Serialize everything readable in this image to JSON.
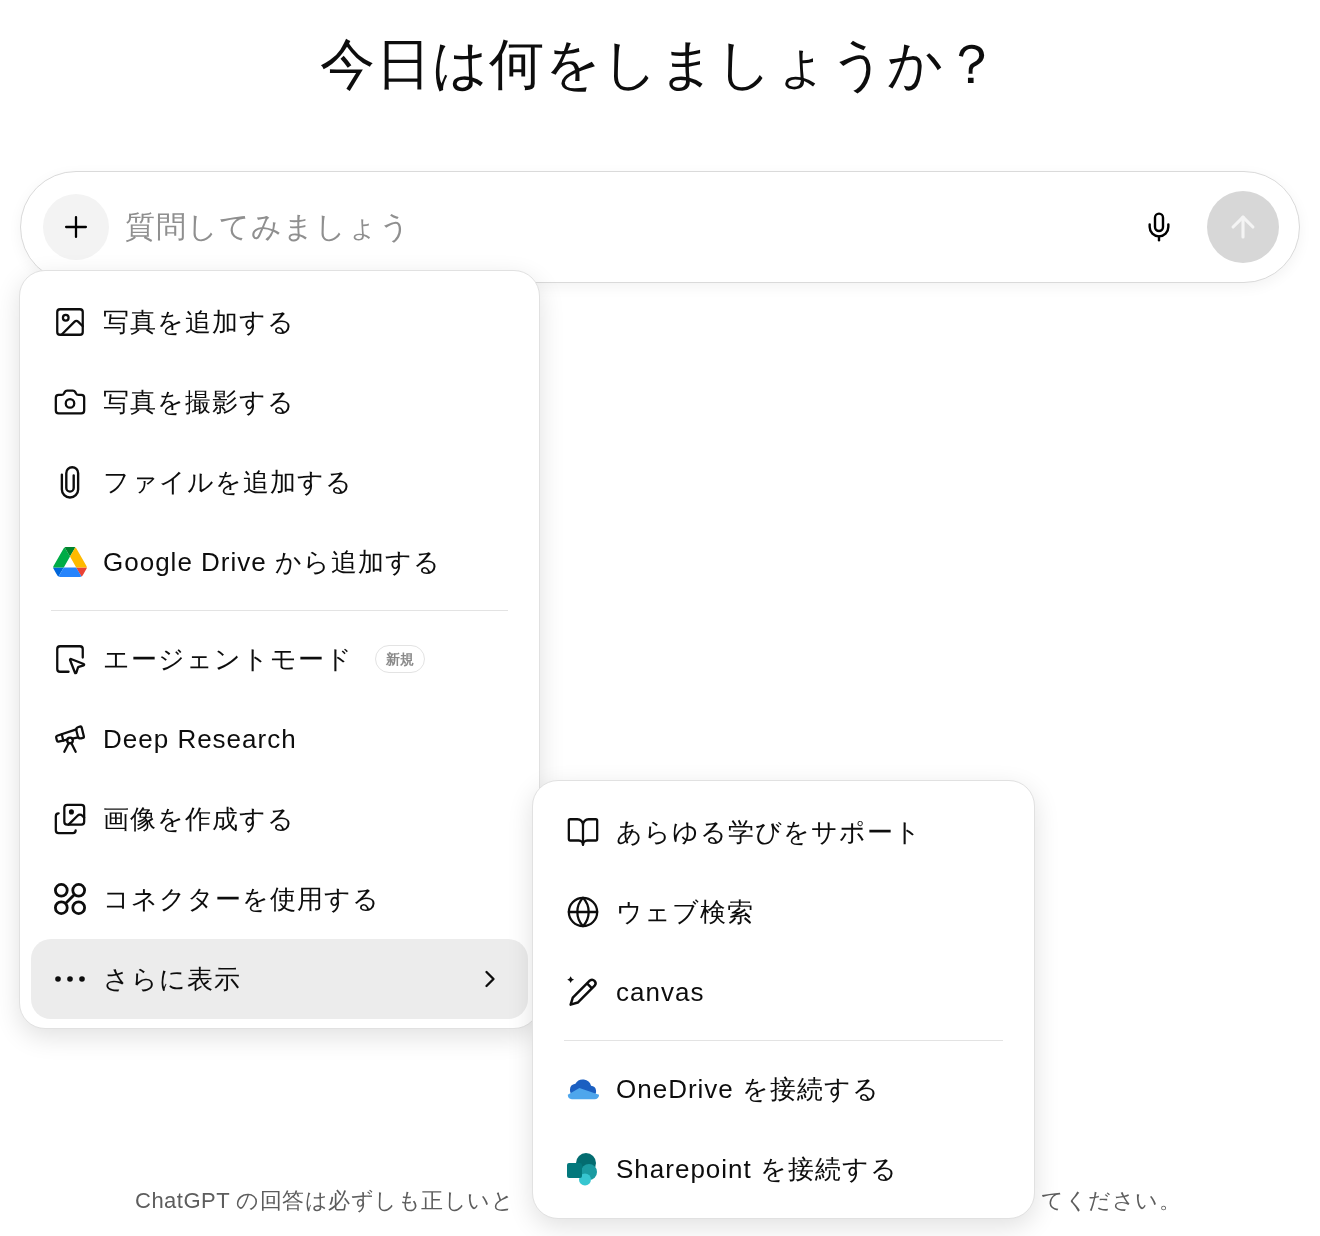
{
  "heading": "今日は何をしましょうか？",
  "composer": {
    "placeholder": "質問してみましょう",
    "send_button": {
      "disabled": true
    }
  },
  "attach_menu": {
    "sections": [
      [
        {
          "label": "写真を追加する",
          "kind": "action",
          "selected": false
        },
        {
          "label": "写真を撮影する",
          "kind": "action",
          "selected": false
        },
        {
          "label": "ファイルを追加する",
          "kind": "action",
          "selected": false
        },
        {
          "label": "Google Drive から追加する",
          "kind": "action",
          "selected": false
        }
      ],
      [
        {
          "label": "エージェントモード",
          "kind": "action",
          "badge": "新規",
          "selected": false
        },
        {
          "label": "Deep Research",
          "kind": "action",
          "selected": false
        },
        {
          "label": "画像を作成する",
          "kind": "action",
          "selected": false
        },
        {
          "label": "コネクターを使用する",
          "kind": "action",
          "selected": false
        },
        {
          "label": "さらに表示",
          "kind": "submenu",
          "selected": true
        }
      ]
    ]
  },
  "more_menu": {
    "sections": [
      [
        {
          "label": "あらゆる学びをサポート",
          "selected": false
        },
        {
          "label": "ウェブ検索",
          "selected": false
        },
        {
          "label": "canvas",
          "selected": false
        }
      ],
      [
        {
          "label": "OneDrive を接続する",
          "selected": false
        },
        {
          "label": "Sharepoint を接続する",
          "selected": false
        }
      ]
    ]
  },
  "footer": {
    "parts": [
      "ChatGPT の回答は必ずしも正しいと",
      "てください。"
    ]
  }
}
